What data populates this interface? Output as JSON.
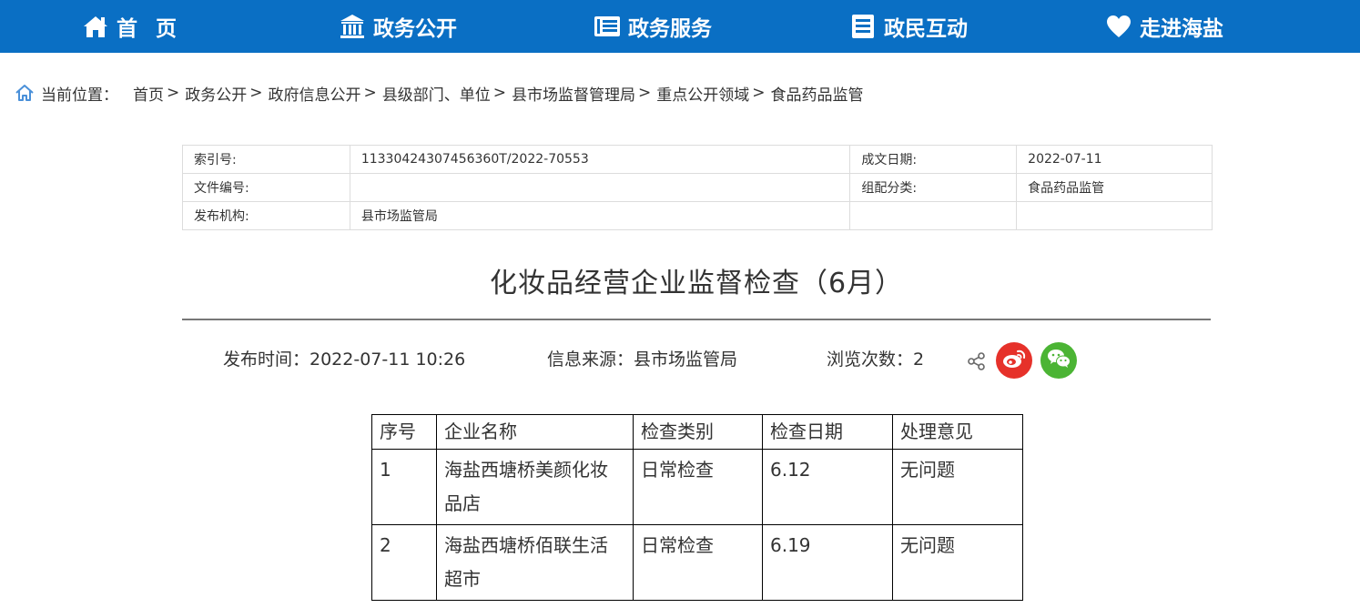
{
  "nav": {
    "items": [
      {
        "label": "首页",
        "icon": "home-icon"
      },
      {
        "label": "政务公开",
        "icon": "building-icon"
      },
      {
        "label": "政务服务",
        "icon": "service-doc-icon"
      },
      {
        "label": "政民互动",
        "icon": "list-doc-icon"
      },
      {
        "label": "走进海盐",
        "icon": "heart-icon"
      }
    ],
    "bg_color": "#0a6fc4"
  },
  "breadcrumb": {
    "label": "当前位置：",
    "items": [
      "首页",
      "政务公开",
      "政府信息公开",
      "县级部门、单位",
      "县市场监督管理局",
      "重点公开领域",
      "食品药品监管"
    ],
    "separator": ">"
  },
  "meta": {
    "index_label": "索引号:",
    "index_value": "11330424307456360T/2022-70553",
    "date_label": "成文日期:",
    "date_value": "2022-07-11",
    "doc_no_label": "文件编号:",
    "doc_no_value": "",
    "category_label": "组配分类:",
    "category_value": "食品药品监管",
    "publisher_label": "发布机构:",
    "publisher_value": "县市场监管局"
  },
  "article": {
    "title": "化妆品经营企业监督检查（6月）",
    "publish_time": "发布时间：2022-07-11 10:26",
    "source": "信息来源：县市场监管局",
    "views": "浏览次数：2"
  },
  "share": {
    "share_icon": "share-icon",
    "weibo_icon": "weibo-icon",
    "wechat_icon": "wechat-icon",
    "weibo_color": "#e6312a",
    "wechat_color": "#4bb434"
  },
  "table": {
    "headers": [
      "序号",
      "企业名称",
      "检查类别",
      "检查日期",
      "处理意见"
    ],
    "rows": [
      [
        "1",
        "海盐西塘桥美颜化妆品店",
        "日常检查",
        "6.12",
        "无问题"
      ],
      [
        "2",
        "海盐西塘桥佰联生活超市",
        "日常检查",
        "6.19",
        "无问题"
      ]
    ]
  }
}
